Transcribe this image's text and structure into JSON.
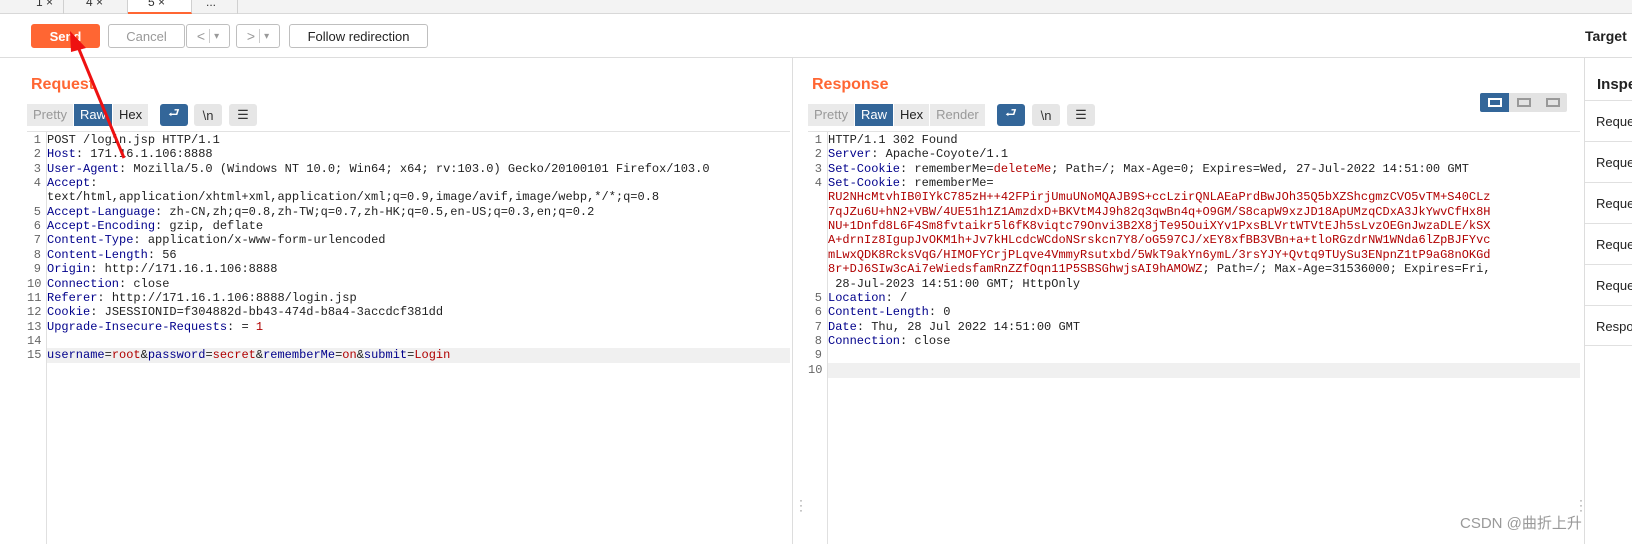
{
  "tabs": [
    "1",
    "4",
    "5",
    "..."
  ],
  "toolbar": {
    "send": "Send",
    "cancel": "Cancel",
    "back": "<",
    "forward": ">",
    "dropdown": "▾",
    "follow": "Follow redirection",
    "target": "Target"
  },
  "request": {
    "title": "Request",
    "views": [
      "Pretty",
      "Raw",
      "Hex"
    ],
    "active_view": "Raw",
    "lines": [
      {
        "n": "1",
        "k": "",
        "v": "POST /login.jsp HTTP/1.1"
      },
      {
        "n": "2",
        "k": "Host",
        "v": " 171.16.1.106:8888"
      },
      {
        "n": "3",
        "k": "User-Agent",
        "v": " Mozilla/5.0 (Windows NT 10.0; Win64; x64; rv:103.0) Gecko/20100101 Firefox/103.0"
      },
      {
        "n": "4",
        "k": "Accept",
        "v": ""
      },
      {
        "n": "",
        "k": "",
        "v": "text/html,application/xhtml+xml,application/xml;q=0.9,image/avif,image/webp,*/*;q=0.8"
      },
      {
        "n": "5",
        "k": "Accept-Language",
        "v": " zh-CN,zh;q=0.8,zh-TW;q=0.7,zh-HK;q=0.5,en-US;q=0.3,en;q=0.2"
      },
      {
        "n": "6",
        "k": "Accept-Encoding",
        "v": " gzip, deflate"
      },
      {
        "n": "7",
        "k": "Content-Type",
        "v": " application/x-www-form-urlencoded"
      },
      {
        "n": "8",
        "k": "Content-Length",
        "v": " 56"
      },
      {
        "n": "9",
        "k": "Origin",
        "v": " http://171.16.1.106:8888"
      },
      {
        "n": "10",
        "k": "Connection",
        "v": " close"
      },
      {
        "n": "11",
        "k": "Referer",
        "v": " http://171.16.1.106:8888/login.jsp"
      },
      {
        "n": "12",
        "k": "Cookie",
        "v": " JSESSIONID=f304882d-bb43-474d-b8a4-3accdcf381dd"
      },
      {
        "n": "13",
        "k": "Upgrade-Insecure-Requests",
        "v": " 1"
      },
      {
        "n": "14",
        "k": "",
        "v": ""
      },
      {
        "n": "15",
        "k": "",
        "v": "username=root&password=secret&rememberMe=on&submit=Login"
      }
    ]
  },
  "response": {
    "title": "Response",
    "views": [
      "Pretty",
      "Raw",
      "Hex",
      "Render"
    ],
    "active_view": "Raw",
    "lines": [
      {
        "n": "1",
        "k": "",
        "v": "HTTP/1.1 302 Found",
        "red": ""
      },
      {
        "n": "2",
        "k": "Server",
        "v": " Apache-Coyote/1.1",
        "red": ""
      },
      {
        "n": "3",
        "k": "Set-Cookie",
        "v": " rememberMe=",
        "red": "deleteMe",
        "tail": "; Path=/; Max-Age=0; Expires=Wed, 27-Jul-2022 14:51:00 GMT"
      },
      {
        "n": "4",
        "k": "Set-Cookie",
        "v": " rememberMe=",
        "red": ""
      },
      {
        "n": "",
        "k": "",
        "v": "",
        "red": "RU2NHcMtvhIB0IYkC785zH++42FPirjUmuUNoMQAJB9S+ccLzirQNLAEaPrdBwJOh35Q5bXZShcgmzCVO5vTM+S40CLz"
      },
      {
        "n": "",
        "k": "",
        "v": "",
        "red": "7qJZu6U+hN2+VBW/4UE51h1Z1AmzdxD+BKVtM4J9h82q3qwBn4q+O9GM/S8capW9xzJD18ApUMzqCDxA3JkYwvCfHx8H"
      },
      {
        "n": "",
        "k": "",
        "v": "",
        "red": "NU+1Dnfd8L6F4Sm8fvtaikr5l6fK8viqtc79Onvi3B2X8jTe95OuiXYv1PxsBLVrtWTVtEJh5sLvzOEGnJwzaDLE/kSX"
      },
      {
        "n": "",
        "k": "",
        "v": "",
        "red": "A+drnIz8IgupJvOKM1h+Jv7kHLcdcWCdoNSrskcn7Y8/oG597CJ/xEY8xfBB3VBn+a+tloRGzdrNW1WNda6lZpBJFYvc"
      },
      {
        "n": "",
        "k": "",
        "v": "",
        "red": "mLwxQDK8RcksVqG/HIMOFYCrjPLqve4VmmyRsutxbd/5WkT9akYn6ymL/3rsYJY+Qvtq9TUySu3ENpnZ1tP9aG8nOKGd"
      },
      {
        "n": "",
        "k": "",
        "v": "",
        "red": "8r+DJ6SIw3cAi7eWiedsfamRnZZfOqn11P5SBSGhwjsAI9hAMOWZ",
        "tail": "; Path=/; Max-Age=31536000; Expires=Fri,"
      },
      {
        "n": "",
        "k": "",
        "v": " 28-Jul-2023 14:51:00 GMT; HttpOnly",
        "red": ""
      },
      {
        "n": "5",
        "k": "Location",
        "v": " /",
        "red": ""
      },
      {
        "n": "6",
        "k": "Content-Length",
        "v": " 0",
        "red": ""
      },
      {
        "n": "7",
        "k": "Date",
        "v": " Thu, 28 Jul 2022 14:51:00 GMT",
        "red": ""
      },
      {
        "n": "8",
        "k": "Connection",
        "v": " close",
        "red": ""
      },
      {
        "n": "9",
        "k": "",
        "v": "",
        "red": ""
      },
      {
        "n": "10",
        "k": "",
        "v": "",
        "red": ""
      }
    ]
  },
  "inspector": {
    "title": "Inspector",
    "items": [
      "Request attributes",
      "Request query parameters",
      "Request body parameters",
      "Request cookies",
      "Request headers",
      "Response headers"
    ]
  },
  "watermark": "CSDN @曲折上升",
  "colors": {
    "accent": "#ff6633",
    "selected": "#336699",
    "header_key": "#00008b",
    "value_red": "#b00000"
  }
}
